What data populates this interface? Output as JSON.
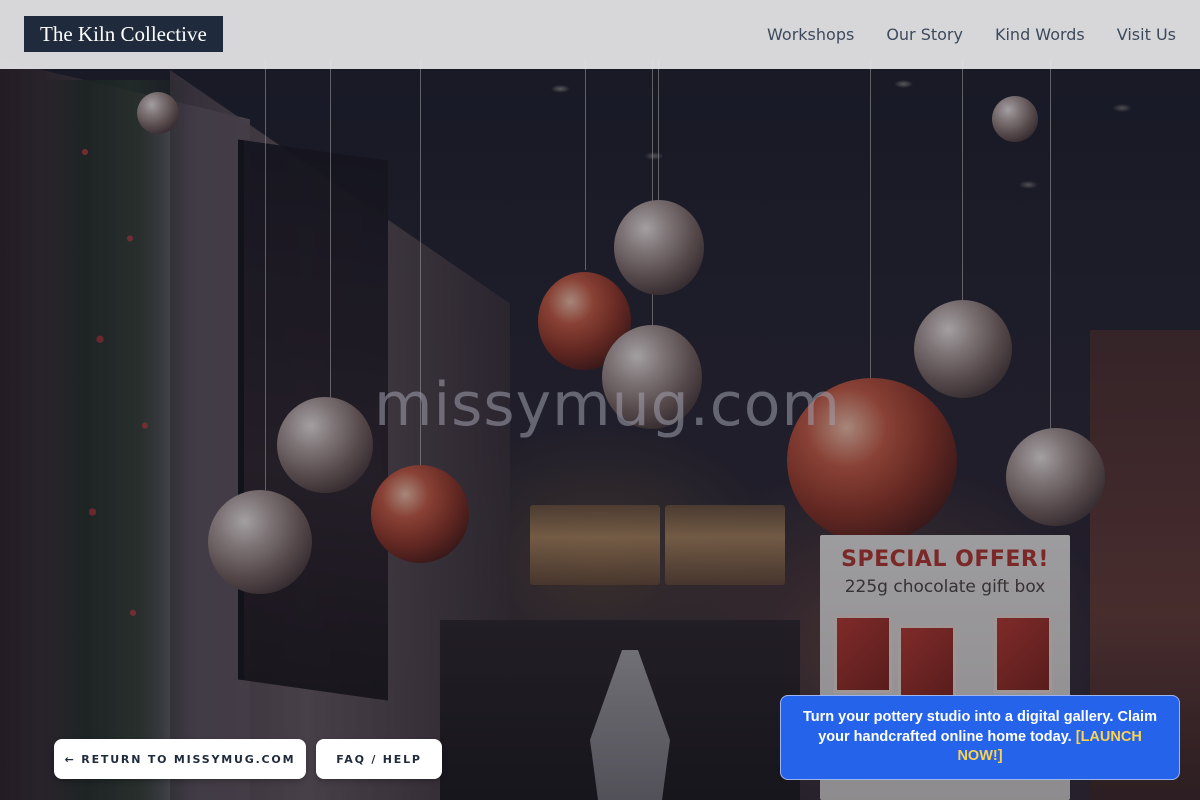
{
  "header": {
    "brand": "The Kiln Collective",
    "nav": [
      {
        "label": "Workshops"
      },
      {
        "label": "Our Story"
      },
      {
        "label": "Kind Words"
      },
      {
        "label": "Visit Us"
      }
    ]
  },
  "hero": {
    "watermark": "missymug.com",
    "sign": {
      "headline": "SPECIAL OFFER!",
      "subline": "225g chocolate gift box"
    }
  },
  "footer_actions": {
    "return_label": "← RETURN TO MISSYMUG.COM",
    "faq_label": "FAQ / HELP"
  },
  "promo": {
    "text": "Turn your pottery studio into a digital gallery. Claim your handcrafted online home today.",
    "cta": "[LAUNCH NOW!]"
  },
  "colors": {
    "brand_bg": "#1f2a3c",
    "promo_bg": "#2563eb",
    "promo_cta": "#fcd34d"
  }
}
